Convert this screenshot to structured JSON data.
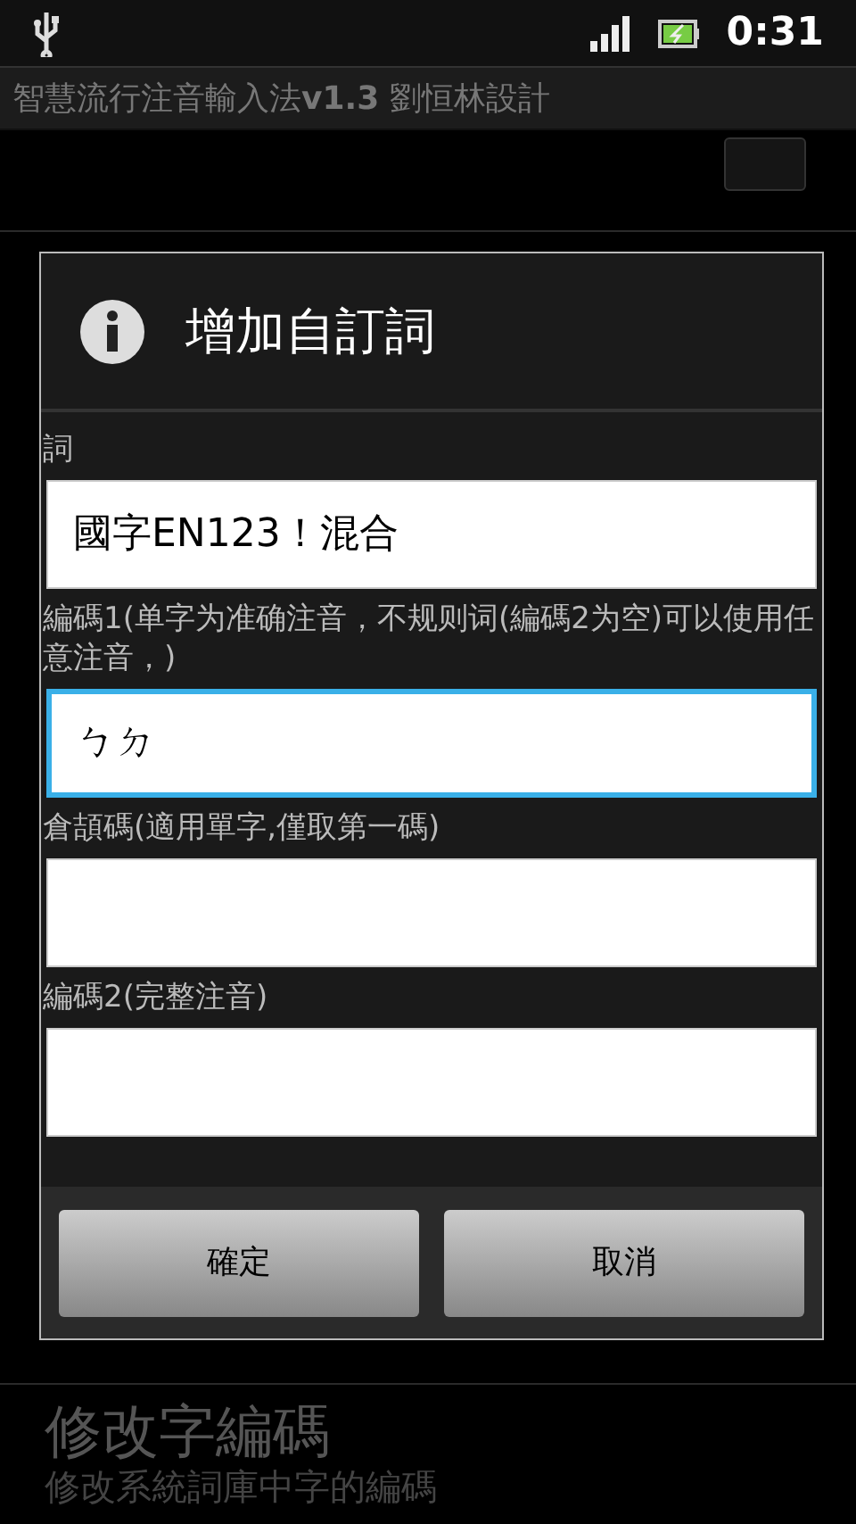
{
  "status_bar": {
    "time": "0:31"
  },
  "app_title": "智慧流行注音輸入法**v1.3** 劉恒林設計",
  "settings": [
    {
      "kind": "checkbox",
      "checked": false
    },
    {
      "kind": "text",
      "title": "修改字編碼",
      "summary": "修改系統詞庫中字的編碼"
    }
  ],
  "dialog": {
    "title": "增加自訂詞",
    "fields": [
      {
        "label": "詞",
        "value": "國字EN123！混合",
        "focused": false
      },
      {
        "label": "編碼1(单字为准确注音，不规则词(編碼2为空)可以使用任意注音，)",
        "value": "ㄅㄉ",
        "focused": true
      },
      {
        "label": "倉頡碼(適用單字,僅取第一碼)",
        "focused": false
      },
      {
        "label": "編碼2(完整注音)",
        "focused": false
      }
    ],
    "buttons": [
      "確定",
      "取消"
    ]
  }
}
